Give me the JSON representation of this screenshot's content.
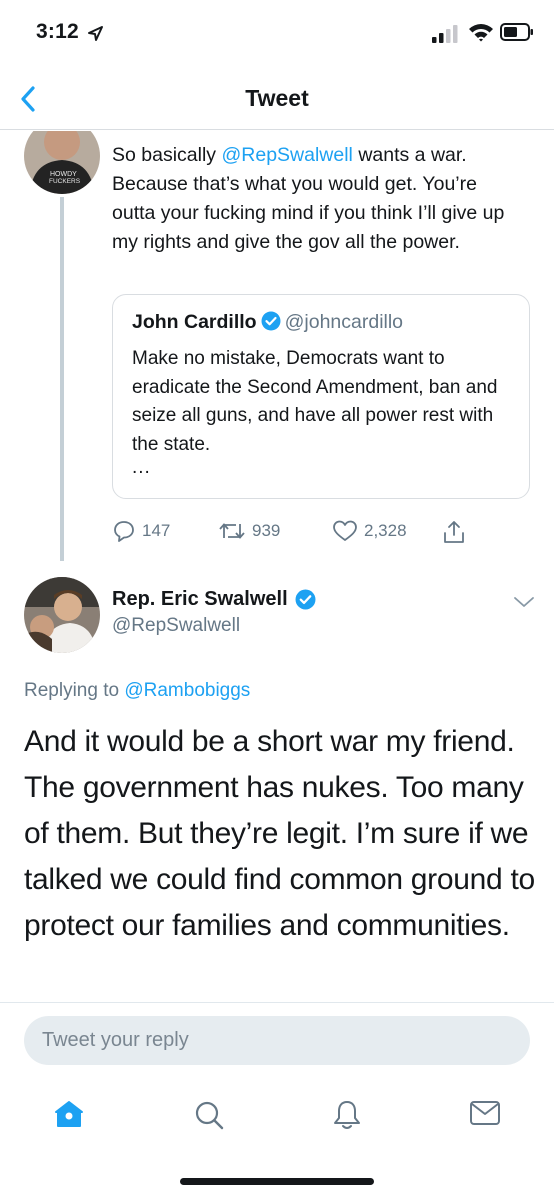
{
  "status_bar": {
    "time": "3:12"
  },
  "nav": {
    "title": "Tweet"
  },
  "parent_tweet": {
    "text_prefix": "So basically ",
    "mention": "@RepSwalwell",
    "text_rest": " wants a war. Because that’s what you would get. You’re outta your fucking mind if you think I’ll give up my rights and give the gov all the power.",
    "quote": {
      "name": "John Cardillo",
      "handle": "@johncardillo",
      "text": "Make no mistake, Democrats want to eradicate the Second Amendment, ban and seize all guns, and have all power rest with the state.",
      "ellipsis": "..."
    },
    "stats": {
      "replies": "147",
      "retweets": "939",
      "likes": "2,328"
    }
  },
  "main_tweet": {
    "name": "Rep. Eric Swalwell",
    "handle": "@RepSwalwell",
    "replying_label": "Replying to ",
    "replying_to": "@Rambobiggs",
    "text": "And it would be a short war my friend. The government has nukes. Too many of them. But they’re legit. I’m sure if we talked we could find common ground to protect our families and communities."
  },
  "reply": {
    "placeholder": "Tweet your reply"
  },
  "colors": {
    "accent": "#1da1f2",
    "text": "#14171a",
    "secondary": "#657786"
  },
  "icons": [
    "location-arrow-icon",
    "signal-icon",
    "wifi-icon",
    "battery-icon",
    "back-icon",
    "verified-icon",
    "reply-icon",
    "retweet-icon",
    "like-icon",
    "share-icon",
    "chevron-down-icon",
    "home-icon",
    "search-icon",
    "notifications-icon",
    "messages-icon"
  ]
}
